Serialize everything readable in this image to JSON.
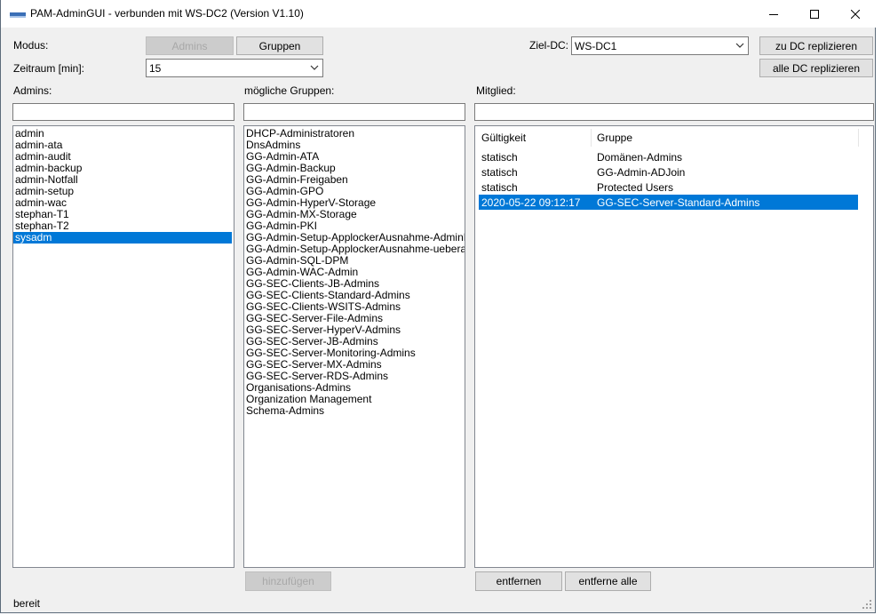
{
  "window": {
    "title": "PAM-AdminGUI - verbunden mit WS-DC2 (Version V1.10)",
    "controls": [
      "minimize-icon",
      "maximize-icon",
      "close-icon"
    ]
  },
  "modus": {
    "label": "Modus:",
    "admins_button": "Admins",
    "gruppen_button": "Gruppen"
  },
  "zeitraum": {
    "label": "Zeitraum [min]:",
    "value": "15"
  },
  "ziel_dc": {
    "label": "Ziel-DC:",
    "value": "WS-DC1",
    "replicate_button": "zu DC replizieren",
    "replicate_all_button": "alle DC replizieren"
  },
  "admins_panel": {
    "label": "Admins:",
    "filter_value": "",
    "items": [
      "admin",
      "admin-ata",
      "admin-audit",
      "admin-backup",
      "admin-Notfall",
      "admin-setup",
      "admin-wac",
      "stephan-T1",
      "stephan-T2",
      "sysadm"
    ],
    "selected": "sysadm"
  },
  "groups_panel": {
    "label": "mögliche Gruppen:",
    "filter_value": "",
    "items": [
      "DHCP-Administratoren",
      "DnsAdmins",
      "GG-Admin-ATA",
      "GG-Admin-Backup",
      "GG-Admin-Freigaben",
      "GG-Admin-GPO",
      "GG-Admin-HyperV-Storage",
      "GG-Admin-MX-Storage",
      "GG-Admin-PKI",
      "GG-Admin-Setup-ApplockerAusnahme-AdminDir",
      "GG-Admin-Setup-ApplockerAusnahme-ueberall",
      "GG-Admin-SQL-DPM",
      "GG-Admin-WAC-Admin",
      "GG-SEC-Clients-JB-Admins",
      "GG-SEC-Clients-Standard-Admins",
      "GG-SEC-Clients-WSITS-Admins",
      "GG-SEC-Server-File-Admins",
      "GG-SEC-Server-HyperV-Admins",
      "GG-SEC-Server-JB-Admins",
      "GG-SEC-Server-Monitoring-Admins",
      "GG-SEC-Server-MX-Admins",
      "GG-SEC-Server-RDS-Admins",
      "Organisations-Admins",
      "Organization Management",
      "Schema-Admins"
    ],
    "add_button": "hinzufügen"
  },
  "member_panel": {
    "label": "Mitglied:",
    "filter_value": "",
    "columns": [
      "Gültigkeit",
      "Gruppe"
    ],
    "rows": [
      {
        "validity": "statisch",
        "group": "Domänen-Admins",
        "selected": false
      },
      {
        "validity": "statisch",
        "group": "GG-Admin-ADJoin",
        "selected": false
      },
      {
        "validity": "statisch",
        "group": "Protected Users",
        "selected": false
      },
      {
        "validity": "2020-05-22 09:12:17",
        "group": "GG-SEC-Server-Standard-Admins",
        "selected": true
      }
    ],
    "remove_button": "entfernen",
    "remove_all_button": "entferne alle"
  },
  "statusbar": {
    "text": "bereit"
  },
  "colors": {
    "selection": "#0078d7",
    "window_bg": "#f0f0f0",
    "disabled_text": "#a8a8a8"
  }
}
